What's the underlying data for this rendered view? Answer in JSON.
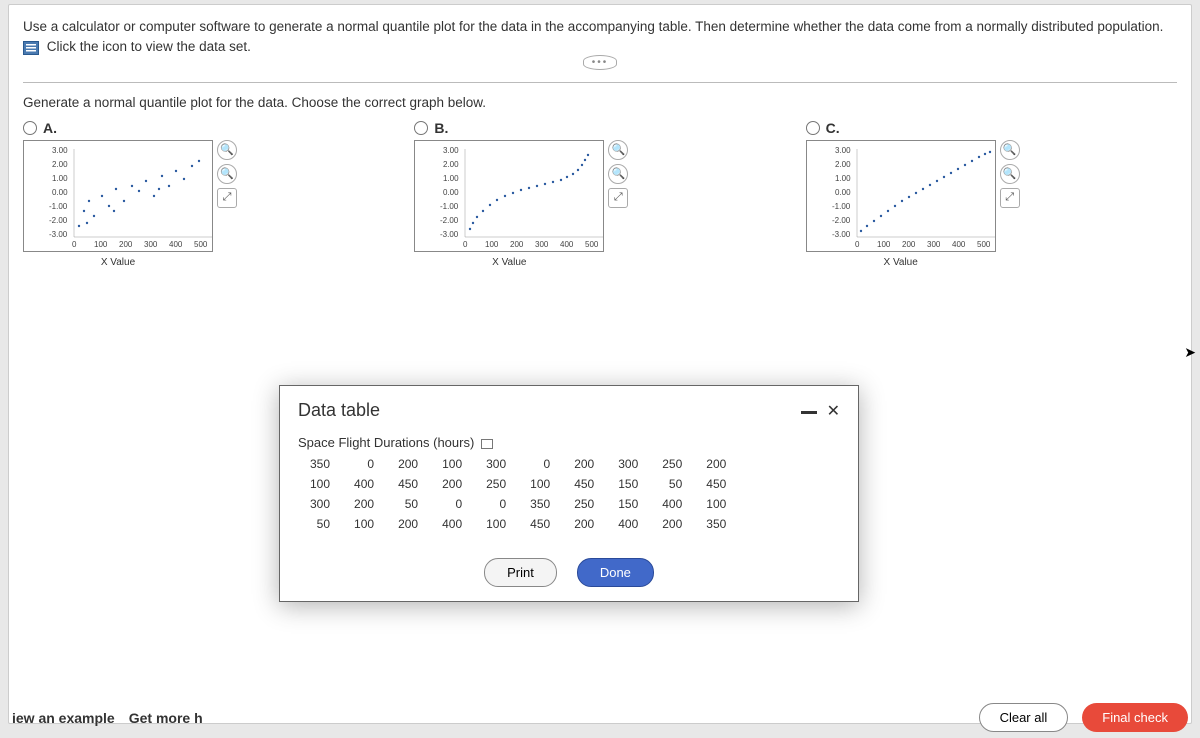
{
  "question": {
    "text": "Use a calculator or computer software to generate a normal quantile plot for the data in the accompanying table. Then determine whether the data come from a normally distributed population.",
    "link_text": "Click the icon to view the data set."
  },
  "instruction": "Generate a normal quantile plot for the data. Choose the correct graph below.",
  "options": {
    "a": "A.",
    "b": "B.",
    "c": "C."
  },
  "plot": {
    "xlabel": "X Value",
    "y_ticks": [
      "3.00",
      "2.00",
      "1.00",
      "0.00",
      "-1.00",
      "-2.00",
      "-3.00"
    ],
    "x_ticks": [
      "0",
      "100",
      "200",
      "300",
      "400",
      "500"
    ]
  },
  "modal": {
    "title": "Data table",
    "table_title": "Space Flight Durations (hours)",
    "rows": [
      [
        350,
        0,
        200,
        100,
        300,
        0,
        200,
        300,
        250,
        200
      ],
      [
        100,
        400,
        450,
        200,
        250,
        100,
        450,
        150,
        50,
        450
      ],
      [
        300,
        200,
        50,
        0,
        0,
        350,
        250,
        150,
        400,
        100
      ],
      [
        50,
        100,
        200,
        400,
        100,
        450,
        200,
        400,
        200,
        350
      ]
    ],
    "print": "Print",
    "done": "Done"
  },
  "footer": {
    "view_example": "iew an example",
    "get_more": "Get more h",
    "clear": "Clear all",
    "final": "Final check"
  },
  "ellipsis": "•••"
}
